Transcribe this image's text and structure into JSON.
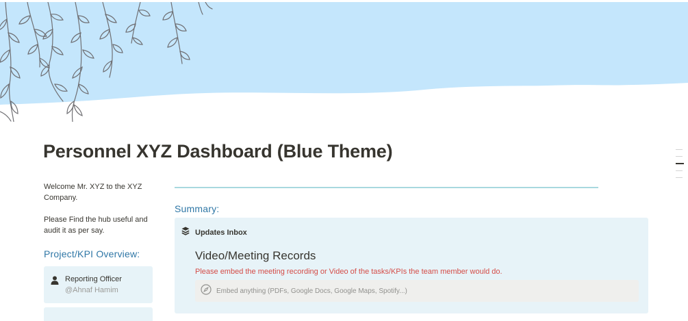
{
  "page": {
    "title": "Personnel XYZ Dashboard (Blue Theme)"
  },
  "colors": {
    "cover_sky": "#c4e6fc",
    "heading_blue": "#2f77a6",
    "callout_bg": "#e7f3f8",
    "red_text": "#d44c47",
    "divider": "#a8d8df"
  },
  "left": {
    "welcome": "Welcome Mr. XYZ to the XYZ Company.",
    "note": "Please Find the hub useful and audit it as per say.",
    "kpi_heading": "Project/KPI Overview:",
    "officer_card": {
      "title": "Reporting Officer",
      "handle": "@Ahnaf Hamim",
      "icon": "person-icon"
    }
  },
  "main": {
    "summary_heading": "Summary:",
    "updates": {
      "label": "Updates Inbox",
      "icon": "layers-icon",
      "video_heading": "Video/Meeting Records",
      "video_desc": "Please embed the meeting recording or Video of the tasks/KPIs the team member would do.",
      "embed_placeholder": "Embed anything (PDFs, Google Docs, Google Maps, Spotify...)",
      "embed_icon": "compass-icon"
    }
  }
}
